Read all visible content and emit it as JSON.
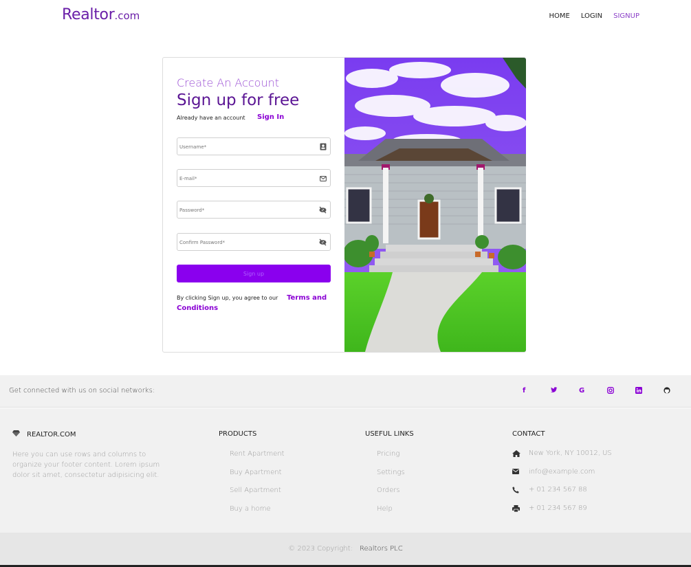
{
  "nav": {
    "brand_main": "Realtor",
    "brand_sub": ".com",
    "links": [
      {
        "label": "HOME"
      },
      {
        "label": "LOGIN"
      },
      {
        "label": "SIGNUP"
      }
    ]
  },
  "form": {
    "create_title": "Create An Account",
    "signup_title": "Sign up for free",
    "already_text": "Already have an account",
    "signin_link": "Sign In",
    "fields": {
      "username": {
        "placeholder": "Username*",
        "icon": "contact-card-icon"
      },
      "email": {
        "placeholder": "E-mail*",
        "icon": "envelope-icon"
      },
      "password": {
        "placeholder": "Password*",
        "icon": "eye-slash-icon"
      },
      "confirm": {
        "placeholder": "Confirm Password*",
        "icon": "eye-slash-icon"
      }
    },
    "submit_label": "Sign up",
    "terms_prefix": "By clicking Sign up, you agree to our",
    "terms_link": "Terms and Conditions"
  },
  "footer": {
    "social_text": "Get connected with us on social networks:",
    "social_icons": [
      {
        "name": "facebook-icon",
        "glyph": "f"
      },
      {
        "name": "twitter-icon",
        "glyph": "🐦"
      },
      {
        "name": "google-icon",
        "glyph": "G"
      },
      {
        "name": "instagram-icon",
        "glyph": "◎"
      },
      {
        "name": "linkedin-icon",
        "glyph": "in"
      },
      {
        "name": "github-icon",
        "glyph": "◯"
      }
    ],
    "about": {
      "heading": "REALTOR.COM",
      "text": "Here you can use rows and columns to organize your footer content. Lorem ipsum dolor sit amet, consectetur adipisicing elit."
    },
    "products": {
      "heading": "PRODUCTS",
      "items": [
        "Rent Apartment",
        "Buy Apartment",
        "Sell Apartment",
        "Buy a home"
      ]
    },
    "useful_links": {
      "heading": "USEFUL LINKS",
      "items": [
        "Pricing",
        "Settings",
        "Orders",
        "Help"
      ]
    },
    "contact": {
      "heading": "CONTACT",
      "items": [
        {
          "icon": "home-icon",
          "text": "New York, NY 10012, US"
        },
        {
          "icon": "envelope-icon",
          "text": "info@example.com"
        },
        {
          "icon": "phone-icon",
          "text": "+ 01 234 567 88"
        },
        {
          "icon": "printer-icon",
          "text": "+ 01 234 567 89"
        }
      ]
    },
    "copyright_text": "© 2023 Copyright:",
    "copyright_owner": "Realtors PLC"
  },
  "colors": {
    "brand": "#6a1fa8",
    "accent": "#8a00ee",
    "footer_bg": "#f1f1f1"
  }
}
